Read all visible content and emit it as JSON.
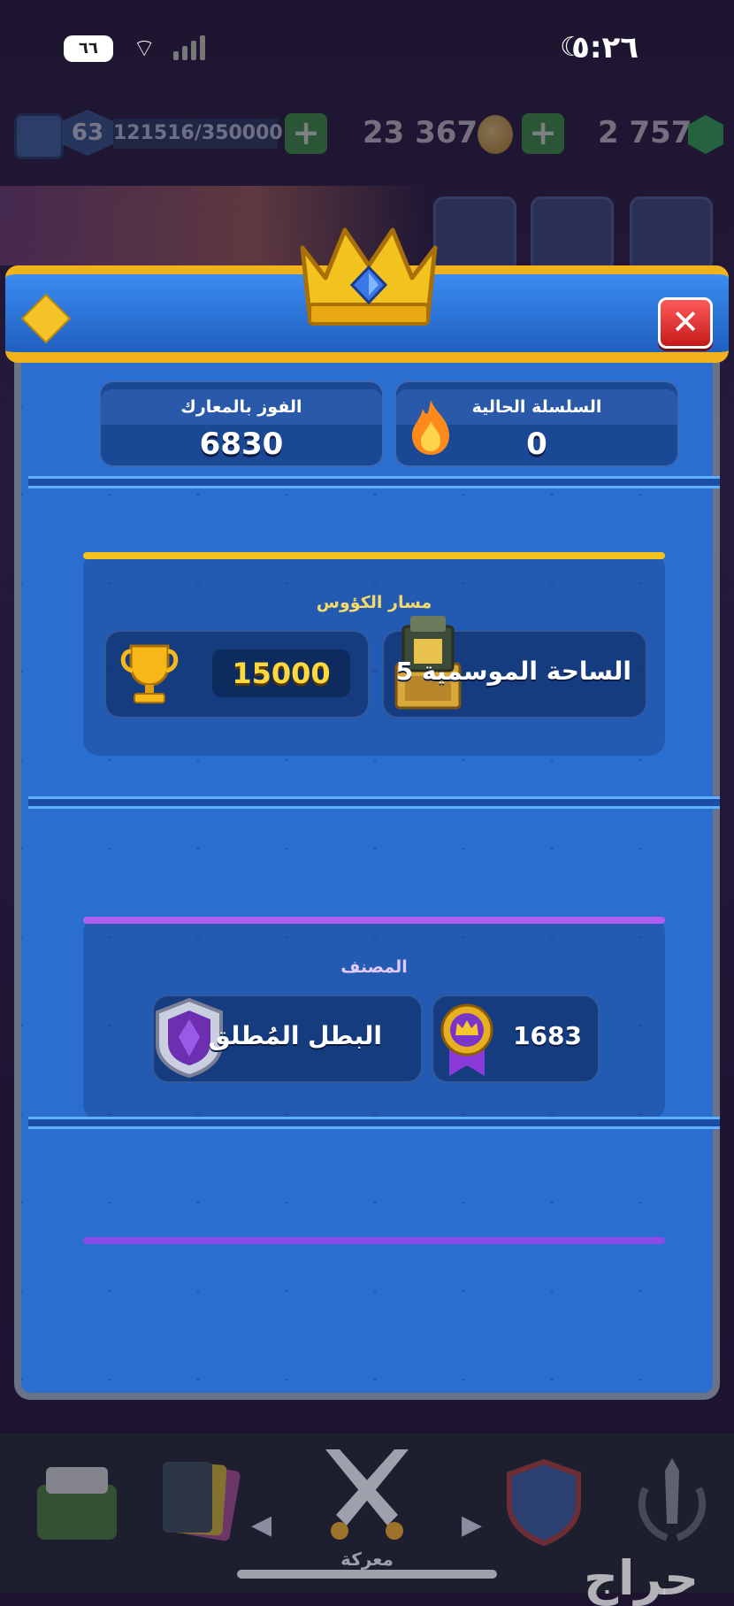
{
  "status_bar": {
    "time": "٥:٢٦",
    "battery": "٦٦"
  },
  "top_bar": {
    "level": "63",
    "xp": "121516/350000",
    "gold": "23 367",
    "gems": "2 757",
    "plus": "+"
  },
  "header": {
    "close": "✕"
  },
  "stats": {
    "battle_wins_label": "الفوز بالمعارك",
    "battle_wins_value": "6830",
    "current_streak_label": "السلسلة الحالية",
    "current_streak_value": "0"
  },
  "trophy_road": {
    "title": "مسار الكؤوس",
    "arena_name": "الساحة الموسمية",
    "arena_number": "5",
    "trophies": "15000"
  },
  "ranked": {
    "title": "المصنف",
    "league_name": "البطل المُطلق",
    "rating": "1683"
  },
  "bottom_nav": {
    "battle_label": "معركة"
  },
  "watermark": "حراج",
  "colors": {
    "banner_gold": "#f2b21b",
    "panel_blue": "#2a6fd0",
    "trophy_gold": "#ffd93b",
    "ranked_purple": "#b05ef0"
  }
}
